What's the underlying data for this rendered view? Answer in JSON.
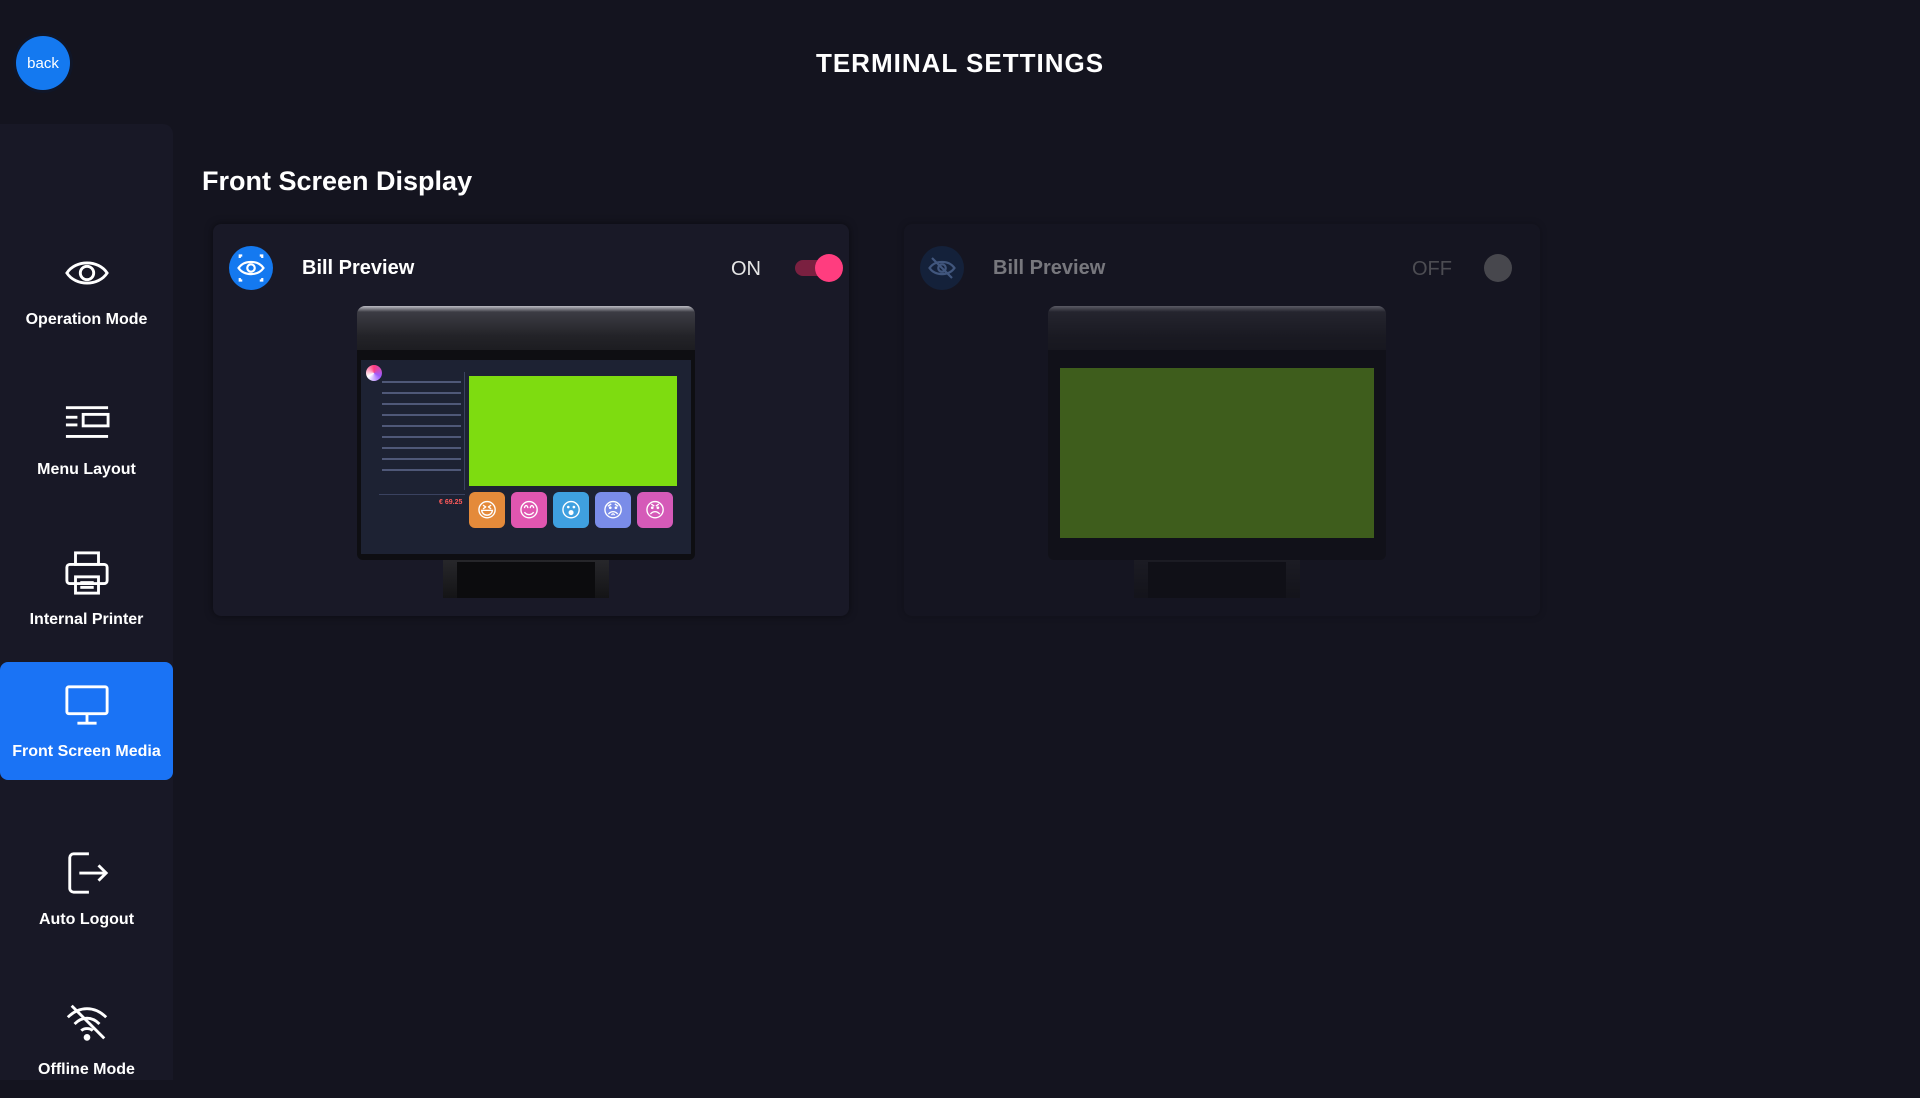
{
  "header": {
    "back_label": "back",
    "title": "TERMINAL SETTINGS"
  },
  "sidebar": {
    "items": [
      {
        "label": "Operation Mode",
        "icon": "eye-icon",
        "active": false
      },
      {
        "label": "Menu Layout",
        "icon": "menu-layout-icon",
        "active": false
      },
      {
        "label": "Internal Printer",
        "icon": "printer-icon",
        "active": false
      },
      {
        "label": "Front Screen Media",
        "icon": "monitor-icon",
        "active": true
      },
      {
        "label": "Auto Logout",
        "icon": "logout-icon",
        "active": false
      },
      {
        "label": "Offline Mode",
        "icon": "wifi-off-icon",
        "active": false
      }
    ]
  },
  "main": {
    "section_title": "Front Screen Display",
    "cards": [
      {
        "title": "Bill Preview",
        "state_label": "ON",
        "enabled": true,
        "icon": "eye-icon"
      },
      {
        "title": "Bill Preview",
        "state_label": "OFF",
        "enabled": false,
        "icon": "eye-slash-icon"
      }
    ]
  },
  "preview": {
    "total_value": "€ 69.25"
  },
  "colors": {
    "background": "#14141f",
    "accent": "#1a73f5",
    "toggle_on": "#ff3d7f",
    "toggle_off": "#8d8d8d",
    "preview_green": "#7edc10"
  }
}
